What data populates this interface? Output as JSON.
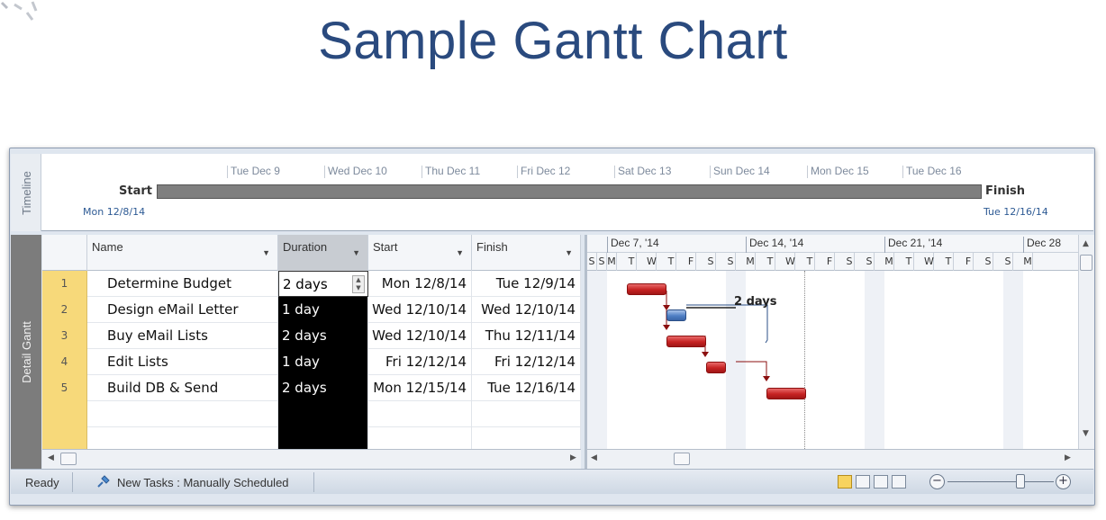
{
  "slide": {
    "title": "Sample Gantt Chart"
  },
  "timeline": {
    "side_label": "Timeline",
    "dates": [
      "Tue Dec 9",
      "Wed Dec 10",
      "Thu Dec 11",
      "Fri Dec 12",
      "Sat Dec 13",
      "Sun Dec 14",
      "Mon Dec 15",
      "Tue Dec 16"
    ],
    "start_label": "Start",
    "start_date": "Mon 12/8/14",
    "finish_label": "Finish",
    "finish_date": "Tue 12/16/14"
  },
  "gantt": {
    "side_label": "Detail Gantt",
    "columns": {
      "name": "Name",
      "duration": "Duration",
      "start": "Start",
      "finish": "Finish"
    },
    "rows": [
      {
        "id": "1",
        "name": "Determine Budget",
        "duration": "2 days",
        "start": "Mon 12/8/14",
        "finish": "Tue 12/9/14"
      },
      {
        "id": "2",
        "name": "Design eMail Letter",
        "duration": "1 day",
        "start": "Wed 12/10/14",
        "finish": "Wed 12/10/14"
      },
      {
        "id": "3",
        "name": "Buy eMail Lists",
        "duration": "2 days",
        "start": "Wed 12/10/14",
        "finish": "Thu 12/11/14"
      },
      {
        "id": "4",
        "name": "Edit Lists",
        "duration": "1 day",
        "start": "Fri 12/12/14",
        "finish": "Fri 12/12/14"
      },
      {
        "id": "5",
        "name": "Build DB & Send",
        "duration": "2 days",
        "start": "Mon 12/15/14",
        "finish": "Tue 12/16/14"
      }
    ],
    "chart": {
      "weeks": [
        "Dec 7, '14",
        "Dec 14, '14",
        "Dec 21, '14",
        "Dec 28"
      ],
      "day_letters": [
        "S",
        "S",
        "M",
        "T",
        "W",
        "T",
        "F",
        "S",
        "S",
        "M",
        "T",
        "W",
        "T",
        "F",
        "S",
        "S",
        "M",
        "T",
        "W",
        "T",
        "F",
        "S",
        "S",
        "M"
      ],
      "duration_label": "2 days",
      "bar_color": "#c62222",
      "selected_bar_color": "#4f7fc5"
    }
  },
  "status_bar": {
    "ready": "Ready",
    "new_tasks": "New Tasks : Manually Scheduled"
  }
}
